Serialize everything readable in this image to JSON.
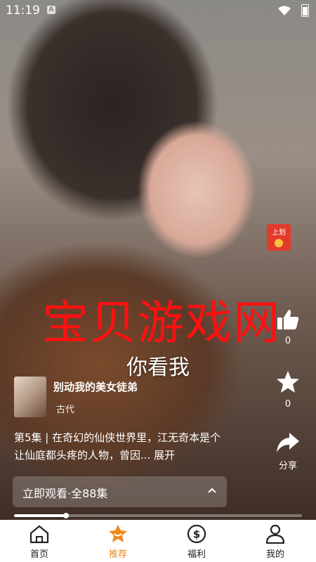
{
  "status_bar": {
    "time": "11:19",
    "notification_icon": "A"
  },
  "video": {
    "watermark": "宝贝游戏网",
    "subtitle": "你看我",
    "progress_fraction": 0.18
  },
  "red_packet": {
    "label": "上划"
  },
  "actions": {
    "like": {
      "icon": "thumbs-up-icon",
      "count": "0"
    },
    "favorite": {
      "icon": "star-icon",
      "count": "0"
    },
    "share": {
      "icon": "share-icon",
      "label": "分享"
    }
  },
  "drama": {
    "title": "别动我的美女徒弟",
    "genre": "古代",
    "description": "第5集 | 在奇幻的仙侠世界里，江无奇本是个让仙庭都头疼的人物，曾因...",
    "expand_label": "展开"
  },
  "watch_bar": {
    "label": "立即观看·全88集"
  },
  "tabs": [
    {
      "label": "首页",
      "icon": "home-icon"
    },
    {
      "label": "推荐",
      "icon": "star-badge-icon"
    },
    {
      "label": "福利",
      "icon": "dollar-icon"
    },
    {
      "label": "我的",
      "icon": "person-icon"
    }
  ],
  "colors": {
    "accent": "#f08a1c",
    "watermark": "#ff1010",
    "red_packet": "#e43a2c"
  }
}
